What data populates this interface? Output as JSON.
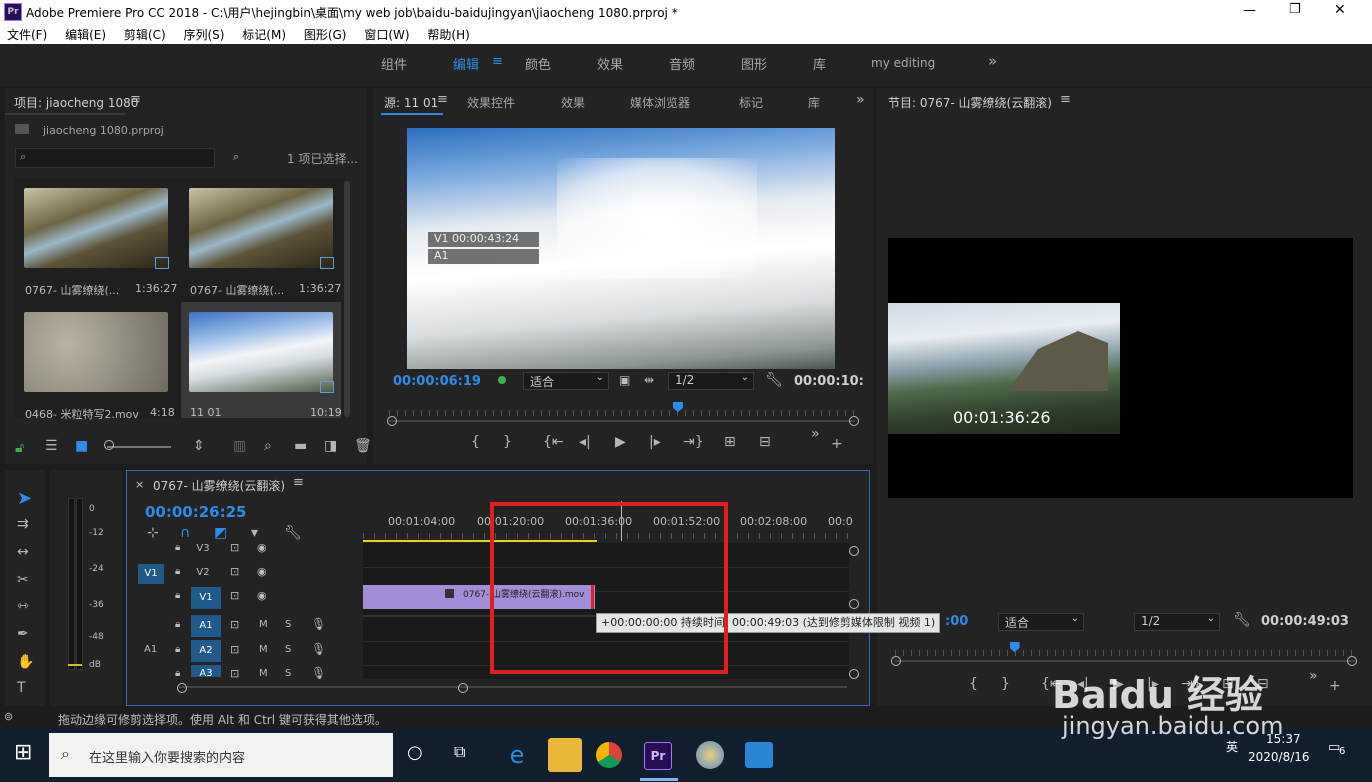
{
  "window": {
    "title": "Adobe Premiere Pro CC 2018 - C:\\用户\\hejingbin\\桌面\\my web job\\baidu-baidujingyan\\jiaocheng 1080.prproj *",
    "app_badge": "Pr",
    "controls": [
      "—",
      "❐",
      "✕"
    ]
  },
  "menu": [
    "文件(F)",
    "编辑(E)",
    "剪辑(C)",
    "序列(S)",
    "标记(M)",
    "图形(G)",
    "窗口(W)",
    "帮助(H)"
  ],
  "workspaces": {
    "tabs": [
      "组件",
      "编辑",
      "颜色",
      "效果",
      "音频",
      "图形",
      "库",
      "my editing"
    ],
    "active": "编辑",
    "more": "»"
  },
  "project": {
    "title": "项目: jiaocheng 1080",
    "file": "jiaocheng 1080.prproj",
    "search_placeholder": "",
    "selection": "1 项已选择...",
    "items": [
      {
        "name": "0767- 山雾缭绕(...",
        "duration": "1:36:27"
      },
      {
        "name": "0767- 山雾缭绕(...",
        "duration": "1:36:27"
      },
      {
        "name": "0468- 米粒特写2.mov",
        "duration": "4:18"
      },
      {
        "name": "11 01",
        "duration": "10:19"
      }
    ]
  },
  "source": {
    "tabs": [
      "源: 11 01",
      "效果控件",
      "效果",
      "媒体浏览器",
      "标记",
      "库"
    ],
    "overlay_v1": "V1 00:00:43:24",
    "overlay_a1": "A1",
    "timecode": "00:00:06:19",
    "fit": "适合",
    "res": "1/2",
    "duration": "00:00:10:",
    "playhead_fraction": 0.62
  },
  "program": {
    "title": "节目: 0767- 山雾缭绕(云翻滚)",
    "overlay_tc": "00:01:36:26",
    "timecode_partial": ":00",
    "fit": "适合",
    "res": "1/2",
    "duration": "00:00:49:03",
    "playhead_fraction": 0.26
  },
  "timeline": {
    "title": "0767- 山雾缭绕(云翻滚)",
    "timecode": "00:00:26:25",
    "ruler": [
      "00:01:04:00",
      "00:01:20:00",
      "00:01:36:00",
      "00:01:52:00",
      "00:02:08:00",
      "00:0"
    ],
    "tracks": {
      "video": [
        {
          "name": "V3",
          "target": ""
        },
        {
          "name": "V2",
          "target": "V1"
        },
        {
          "name": "V1",
          "target": ""
        }
      ],
      "audio": [
        {
          "name": "A1",
          "target": ""
        },
        {
          "name": "A2",
          "target": "A1"
        },
        {
          "name": "A3",
          "target": ""
        }
      ],
      "mute": "M",
      "solo": "S"
    },
    "clip_label": "0767- 山雾缭绕(云翻滚).mov",
    "tooltip": "+00:00:00:00 持续时间: 00:00:49:03 (达到修剪媒体限制 视频 1)"
  },
  "meter": {
    "labels": [
      "0",
      "-12",
      "-24",
      "-36",
      "-48",
      "dB"
    ]
  },
  "status": "拖动边缘可修剪选择项。使用 Alt 和 Ctrl 键可获得其他选项。",
  "taskbar": {
    "search": "在这里输入你要搜索的内容",
    "time": "15:37",
    "date": "2020/8/16",
    "lang": "英",
    "notif": "6"
  },
  "watermark": {
    "brand": "Baidu 经验",
    "url": "jingyan.baidu.com"
  },
  "colors": {
    "accent": "#2d8ceb",
    "highlight_box": "#e0201f",
    "clip": "#a28ed8"
  }
}
